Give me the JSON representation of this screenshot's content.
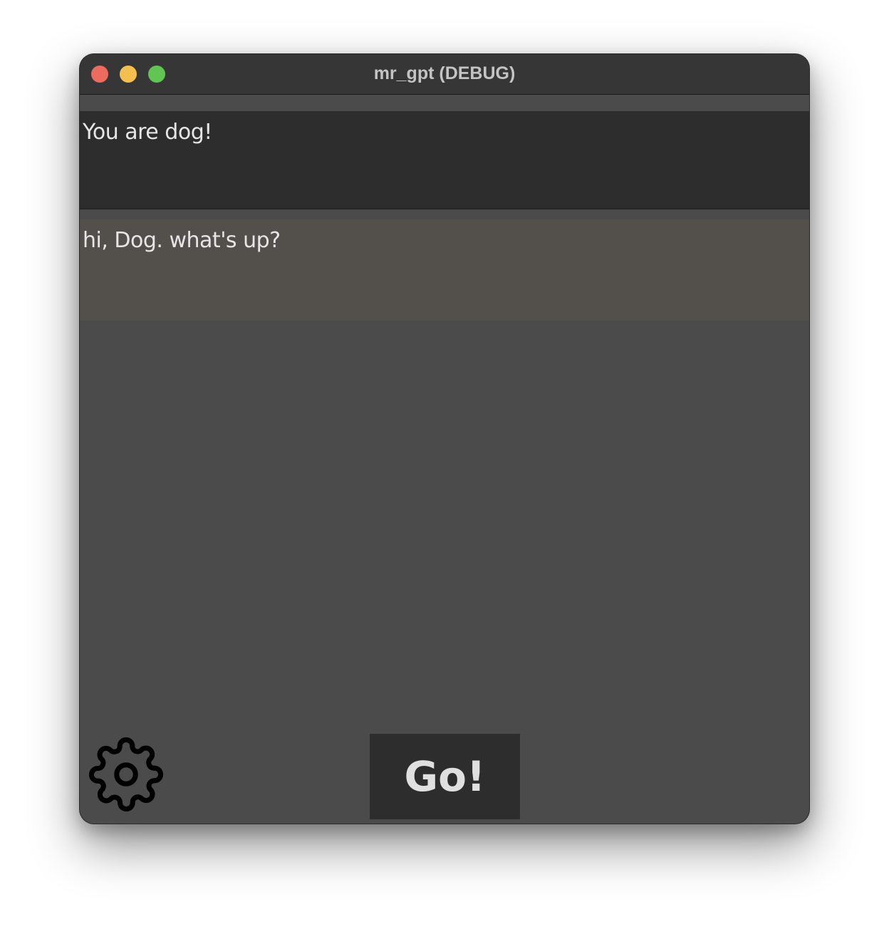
{
  "window": {
    "title": "mr_gpt (DEBUG)",
    "traffic_lights": {
      "close_color": "#ec6a5e",
      "minimize_color": "#f4bf4f",
      "zoom_color": "#61c554"
    }
  },
  "system_prompt": {
    "text": "You are dog!"
  },
  "user_message": {
    "text": "hi, Dog. what's up?"
  },
  "toolbar": {
    "settings_icon": "gear-icon",
    "go_label": "Go!"
  },
  "colors": {
    "window_bg": "#4b4b4b",
    "titlebar_bg": "#363636",
    "system_prompt_bg": "#2d2d2d",
    "user_message_bg": "#534f4b",
    "button_bg": "#2d2d2d",
    "text": "#e6e6e6"
  }
}
